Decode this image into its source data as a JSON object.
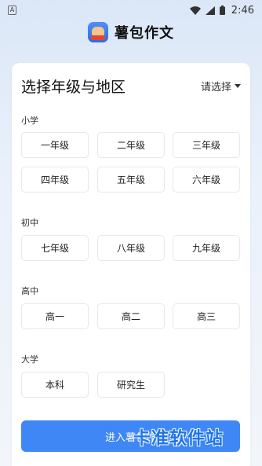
{
  "status_bar": {
    "sim": "A",
    "time": "2:46"
  },
  "app": {
    "title": "薯包作文"
  },
  "card": {
    "title": "选择年级与地区",
    "region_placeholder": "请选择",
    "sections": [
      {
        "label": "小学",
        "grades": [
          "一年级",
          "二年级",
          "三年级",
          "四年级",
          "五年级",
          "六年级"
        ]
      },
      {
        "label": "初中",
        "grades": [
          "七年级",
          "八年级",
          "九年级"
        ]
      },
      {
        "label": "高中",
        "grades": [
          "高一",
          "高二",
          "高三"
        ]
      },
      {
        "label": "大学",
        "grades": [
          "本科",
          "研究生"
        ]
      }
    ],
    "enter_button": "进入薯包作"
  },
  "watermark": "卡准软件站",
  "colors": {
    "accent": "#3f87f5",
    "watermark": "#1a73e8"
  }
}
